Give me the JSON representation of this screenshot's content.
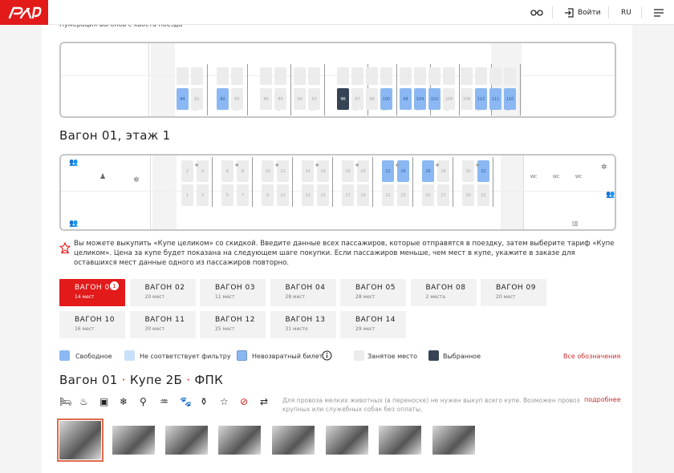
{
  "header": {
    "logo_text": "РЖД",
    "signin_label": "Войти",
    "lang": "RU"
  },
  "top_note": "Нумерация вагонов с хвоста поезда",
  "car_floor_title": "Вагон 01, этаж 1",
  "upper_seats": [
    {
      "n": "84",
      "state": "free"
    },
    {
      "n": "81",
      "state": "taken"
    },
    {
      "n": "82",
      "state": "free"
    },
    {
      "n": "85",
      "state": "taken"
    },
    {
      "n": "86",
      "state": "taken"
    },
    {
      "n": "89",
      "state": "taken"
    },
    {
      "n": "90",
      "state": "taken"
    },
    {
      "n": "93",
      "state": "taken"
    },
    {
      "n": "96",
      "state": "selected"
    },
    {
      "n": "97",
      "state": "taken"
    },
    {
      "n": "98",
      "state": "taken"
    },
    {
      "n": "100",
      "state": "free"
    },
    {
      "n": "98",
      "state": "free"
    },
    {
      "n": "104",
      "state": "free"
    },
    {
      "n": "102",
      "state": "free"
    },
    {
      "n": "108",
      "state": "taken"
    },
    {
      "n": "106",
      "state": "taken"
    },
    {
      "n": "112",
      "state": "free"
    },
    {
      "n": "111",
      "state": "free"
    },
    {
      "n": "110",
      "state": "free"
    }
  ],
  "lower_seats": [
    {
      "n": "2",
      "state": "taken"
    },
    {
      "n": "4",
      "state": "taken"
    },
    {
      "n": "6",
      "state": "taken"
    },
    {
      "n": "8",
      "state": "taken"
    },
    {
      "n": "10",
      "state": "taken"
    },
    {
      "n": "12",
      "state": "taken"
    },
    {
      "n": "14",
      "state": "taken"
    },
    {
      "n": "16",
      "state": "taken"
    },
    {
      "n": "18",
      "state": "taken"
    },
    {
      "n": "20",
      "state": "taken"
    },
    {
      "n": "22",
      "state": "free"
    },
    {
      "n": "24",
      "state": "free"
    },
    {
      "n": "26",
      "state": "free"
    },
    {
      "n": "28",
      "state": "taken"
    },
    {
      "n": "30",
      "state": "taken"
    },
    {
      "n": "32",
      "state": "free"
    }
  ],
  "lower_row2": [
    "1",
    "3",
    "5",
    "7",
    "9",
    "11",
    "13",
    "15",
    "17",
    "19",
    "21",
    "23",
    "25",
    "27",
    "29",
    "31"
  ],
  "wc_labels": [
    "WC",
    "WC",
    "WC"
  ],
  "info_text": "Вы можете выкупить «Купе целиком» со скидкой. Введите данные всех пассажиров, которые отправятся в поездку, затем выберите тариф «Купе целиком». Цена за купе будет показана на следующем шаге покупки. Если пассажиров меньше, чем мест в купе, укажите в заказе для оставшихся мест данные одного из пассажиров повторно.",
  "wagons": [
    {
      "name": "ВАГОН 01",
      "seats": "14 мест",
      "badge": "1"
    },
    {
      "name": "ВАГОН 02",
      "seats": "20 мест"
    },
    {
      "name": "ВАГОН 03",
      "seats": "11 мест"
    },
    {
      "name": "ВАГОН 04",
      "seats": "28 мест"
    },
    {
      "name": "ВАГОН 05",
      "seats": "28 мест"
    },
    {
      "name": "ВАГОН 08",
      "seats": "2 места"
    },
    {
      "name": "ВАГОН 09",
      "seats": "20 мест"
    },
    {
      "name": "ВАГОН 10",
      "seats": "16 мест"
    },
    {
      "name": "ВАГОН 11",
      "seats": "30 мест"
    },
    {
      "name": "ВАГОН 12",
      "seats": "25 мест"
    },
    {
      "name": "ВАГОН 13",
      "seats": "31 место"
    },
    {
      "name": "ВАГОН 14",
      "seats": "29 мест"
    }
  ],
  "legend": {
    "free": "Свободное",
    "no_filter": "Не соответствует фильтру",
    "nonrefund": "Невозвратный билет",
    "taken": "Занятое место",
    "selected": "Выбранное",
    "all_link": "Все обозначения"
  },
  "colors": {
    "brand": "#e21a1a",
    "free": "#8bb8f2",
    "no_filter": "#c9e0fa",
    "taken": "#ececec",
    "selected": "#364354"
  },
  "car_heading": {
    "car": "Вагон 01",
    "compartment": "Купе 2Б",
    "carrier": "ФПК",
    "dot": "·"
  },
  "amenities": [
    "bed-icon",
    "dry-closet-icon",
    "tv-icon",
    "snowflake-icon",
    "toilet-icon",
    "shower-icon",
    "pet-icon",
    "bio-toilet-icon",
    "star-icon",
    "no-smoking-icon",
    "transfer-icon"
  ],
  "animal_note": "Для провоза мелких животных (в переноске) не нужен выкуп всего купе. Возможен провоз крупных или служебных собак без оплаты,",
  "more_link": "подробнее"
}
